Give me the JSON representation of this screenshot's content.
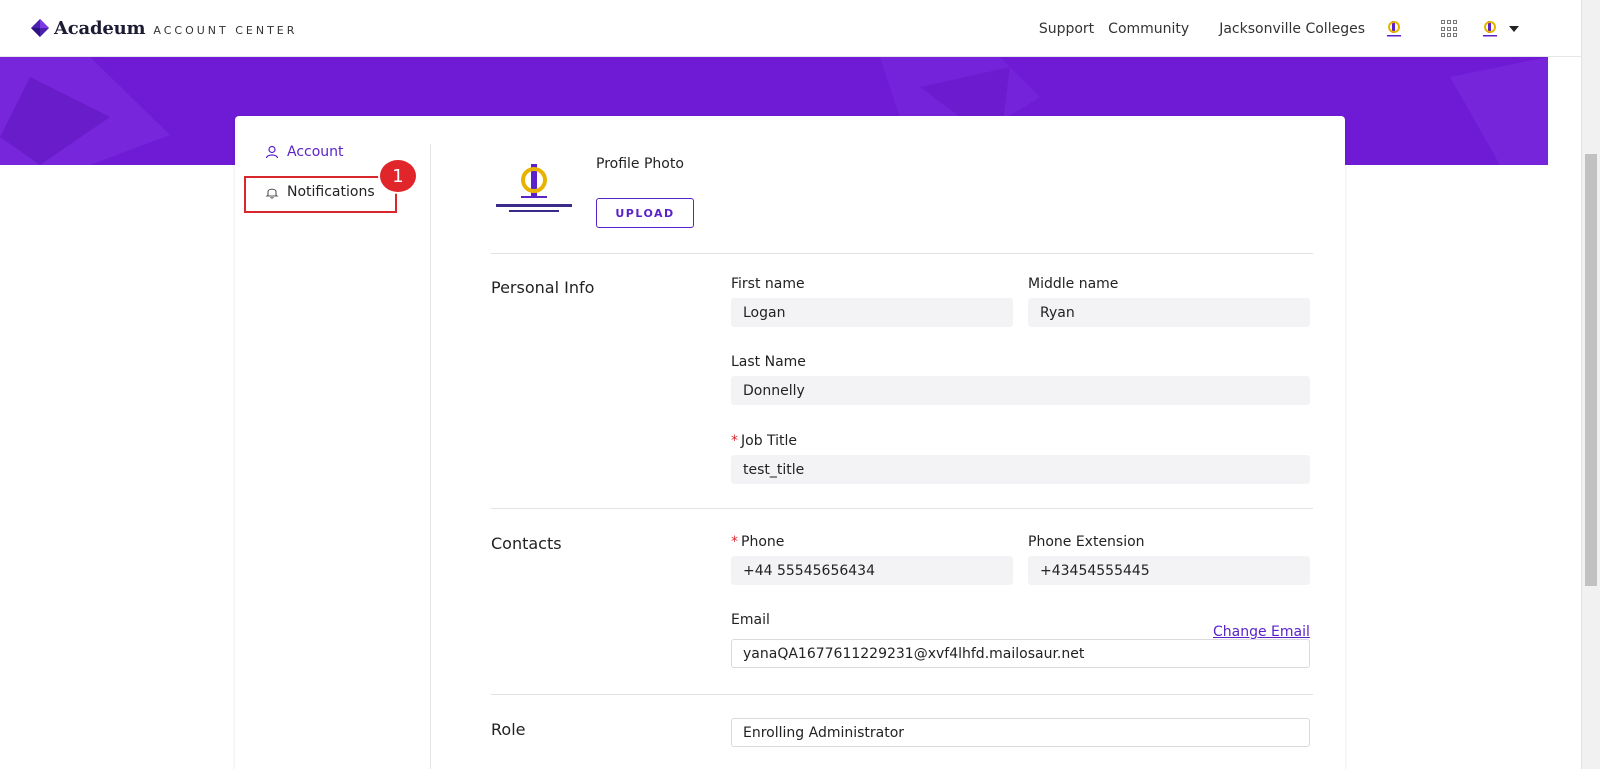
{
  "header": {
    "brand_name": "Acadeum",
    "brand_sub": "ACCOUNT CENTER",
    "links": [
      "Support",
      "Community"
    ],
    "org_name": "Jacksonville Colleges"
  },
  "sidebar": {
    "items": [
      {
        "label": "Account",
        "icon": "user-icon"
      },
      {
        "label": "Notifications",
        "icon": "bell-icon"
      }
    ],
    "annotation_badge": "1"
  },
  "profile": {
    "photo_label": "Profile Photo",
    "upload_label": "UPLOAD"
  },
  "personal_info": {
    "title": "Personal Info",
    "first_name_label": "First name",
    "first_name": "Logan",
    "middle_name_label": "Middle name",
    "middle_name": "Ryan",
    "last_name_label": "Last Name",
    "last_name": "Donnelly",
    "job_title_label": "Job Title",
    "job_title": "test_title"
  },
  "contacts": {
    "title": "Contacts",
    "phone_label": "Phone",
    "phone": "+44 55545656434",
    "phone_ext_label": "Phone Extension",
    "phone_ext": "+43454555445",
    "email_label": "Email",
    "email": "yanaQA1677611229231@xvf4lhfd.mailosaur.net",
    "change_email": "Change Email"
  },
  "role": {
    "title": "Role",
    "value": "Enrolling Administrator"
  },
  "colors": {
    "accent": "#5a22c9",
    "banner": "#6f1bd6",
    "highlight": "#d9272e"
  }
}
